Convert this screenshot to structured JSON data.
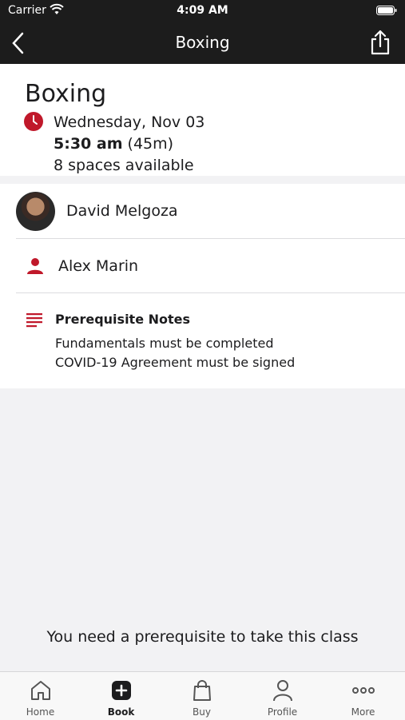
{
  "status_bar": {
    "carrier": "Carrier",
    "time": "4:09 AM"
  },
  "nav": {
    "title": "Boxing"
  },
  "class": {
    "name": "Boxing",
    "date": "Wednesday, Nov 03",
    "start_time": "5:30 am",
    "duration": "(45m)",
    "spaces": "8 spaces available"
  },
  "instructor": {
    "name": "David Melgoza"
  },
  "assistant": {
    "name": "Alex Marin"
  },
  "prerequisites": {
    "title": "Prerequisite Notes",
    "lines": [
      "Fundamentals must be completed",
      "COVID-19 Agreement must be signed"
    ]
  },
  "footer_message": "You need a prerequisite to take this class",
  "tabs": [
    {
      "label": "Home",
      "icon": "home-icon"
    },
    {
      "label": "Book",
      "icon": "plus-square-icon"
    },
    {
      "label": "Buy",
      "icon": "shopping-bag-icon"
    },
    {
      "label": "Profile",
      "icon": "person-icon"
    },
    {
      "label": "More",
      "icon": "more-dots-icon"
    }
  ],
  "colors": {
    "accent": "#c0182a",
    "dark_bar": "#1c1c1c"
  }
}
